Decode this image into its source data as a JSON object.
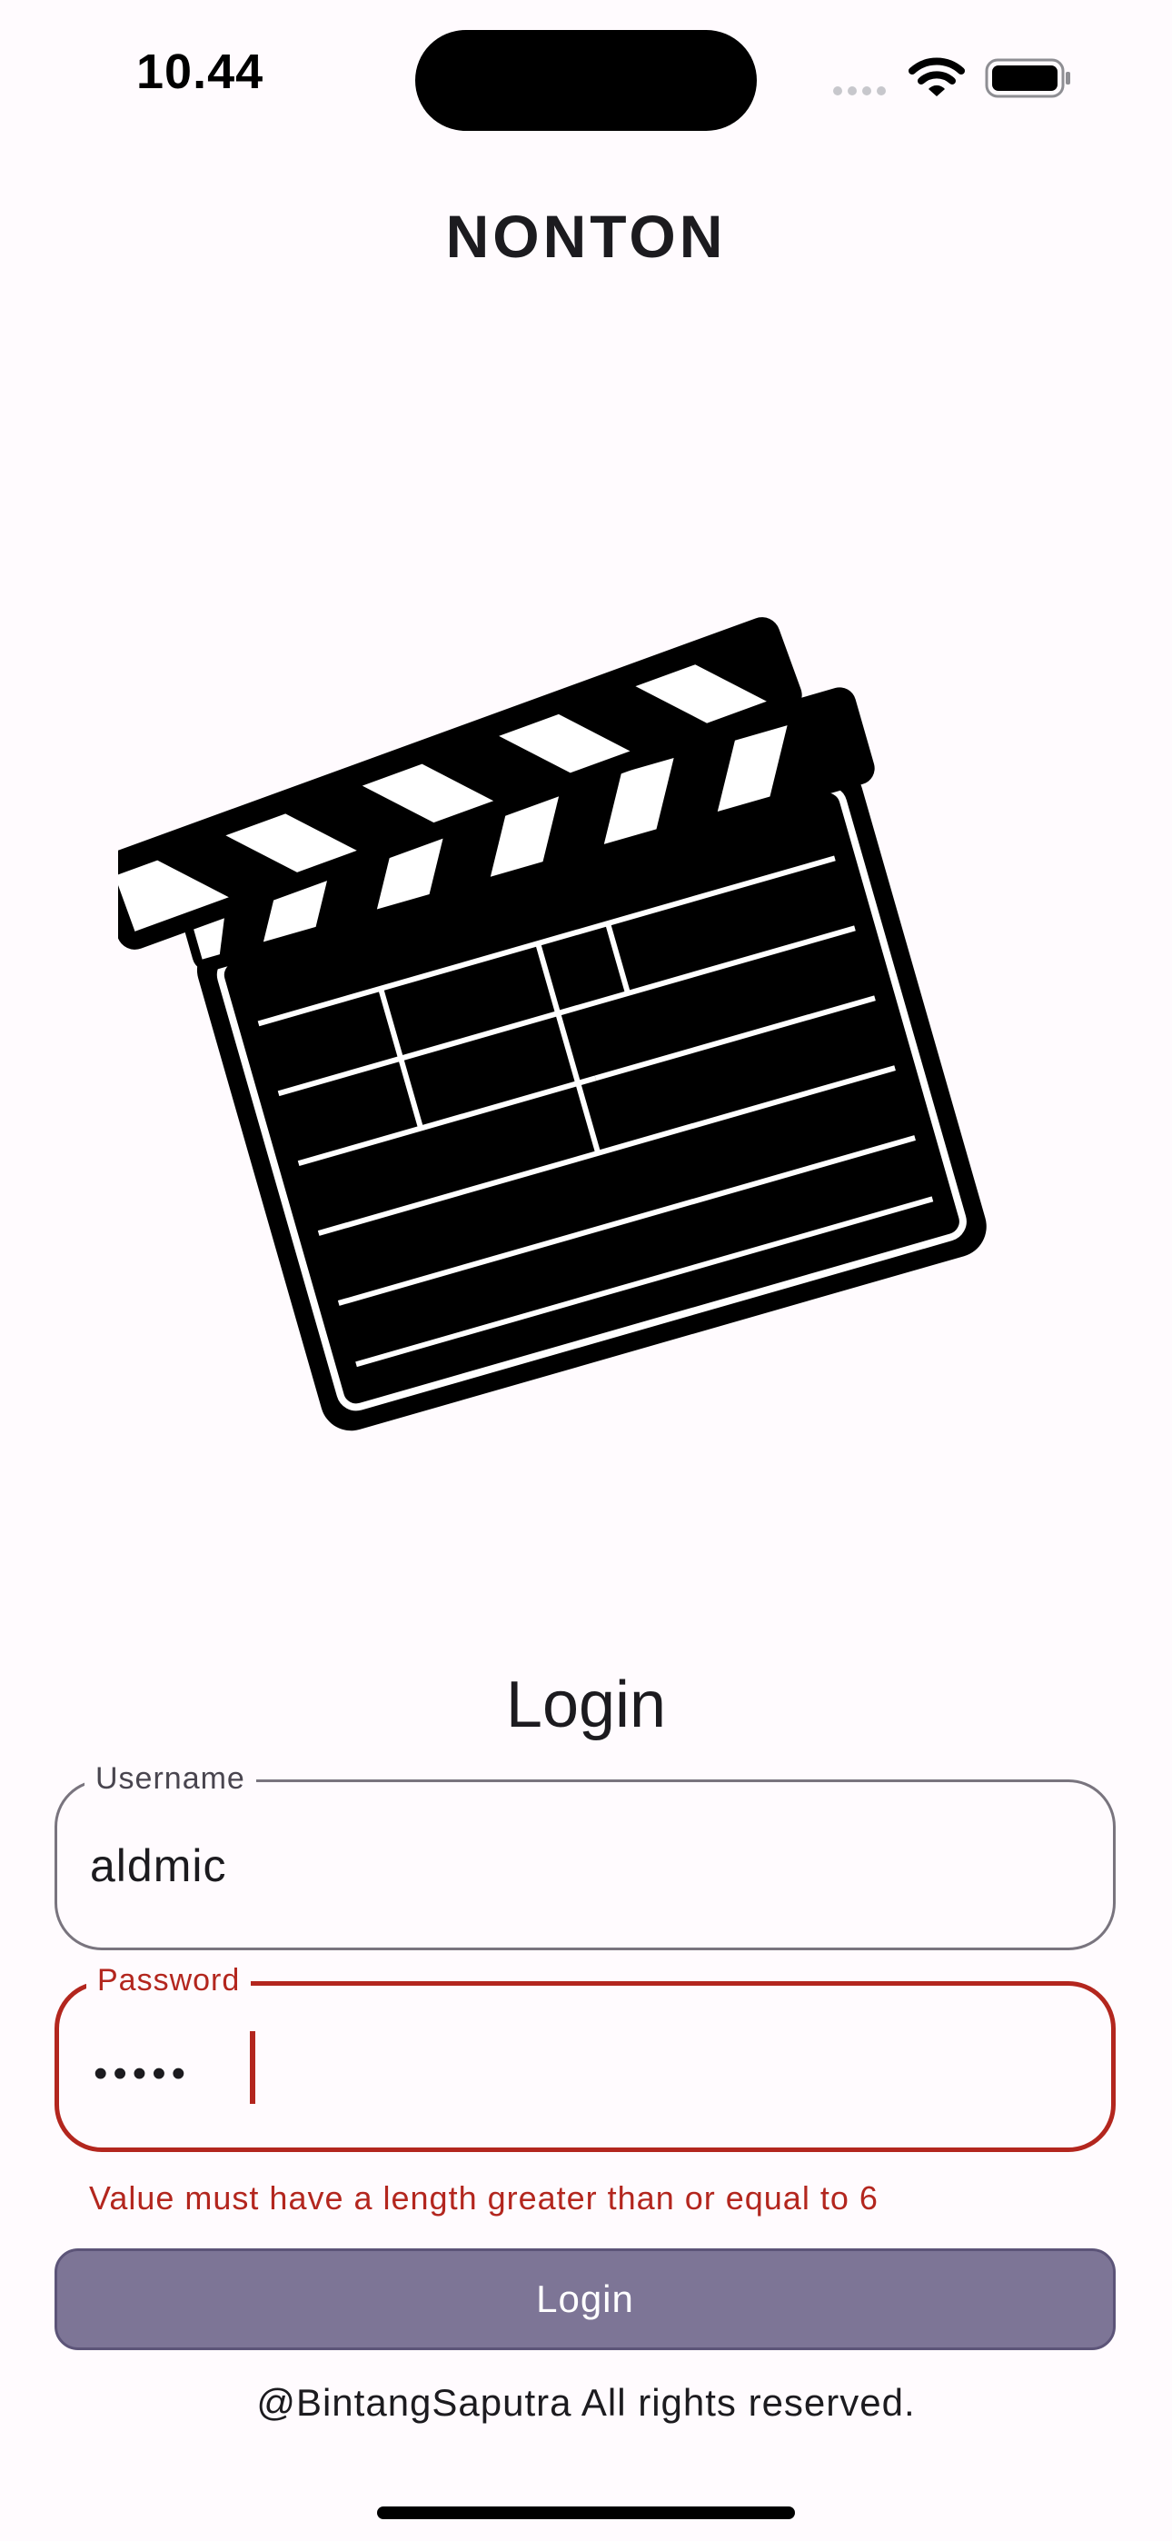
{
  "status_bar": {
    "time": "10.44"
  },
  "app": {
    "title": "NONTON"
  },
  "form": {
    "heading": "Login",
    "username": {
      "label": "Username",
      "value": "aldmic"
    },
    "password": {
      "label": "Password",
      "masked_value": "•••••",
      "error": "Value must have a length greater than or equal to 6"
    },
    "submit_label": "Login"
  },
  "footer": {
    "text": "@BintangSaputra All rights reserved."
  },
  "icons": {
    "status": [
      "cellular-signal-icon",
      "wifi-icon",
      "battery-icon"
    ],
    "hero": "clapperboard-icon"
  },
  "colors": {
    "background": "#fffbfe",
    "error": "#b3261e",
    "button": "#7d7596",
    "text": "#1c1b1f"
  }
}
